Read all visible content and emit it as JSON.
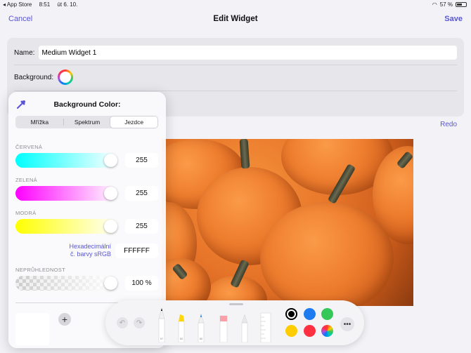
{
  "status_bar": {
    "back_app": "◂ App Store",
    "time": "8:51",
    "date": "út 6. 10.",
    "battery_text": "57 %",
    "battery_level": 0.57
  },
  "nav": {
    "cancel_label": "Cancel",
    "title": "Edit Widget",
    "save_label": "Save"
  },
  "form": {
    "name_label": "Name:",
    "name_value": "Medium Widget 1",
    "background_label": "Background:"
  },
  "redo_label": "Redo",
  "color_picker": {
    "title": "Background Color:",
    "tabs": [
      {
        "label": "Mřížka"
      },
      {
        "label": "Spektrum"
      },
      {
        "label": "Jezdce",
        "active": true
      }
    ],
    "sliders": [
      {
        "label": "ČERVENÁ",
        "value": "255",
        "gradient_from": "#00ffff",
        "gradient_to": "#ffffff"
      },
      {
        "label": "ZELENÁ",
        "value": "255",
        "gradient_from": "#ff00ff",
        "gradient_to": "#ffffff"
      },
      {
        "label": "MODRÁ",
        "value": "255",
        "gradient_from": "#ffff00",
        "gradient_to": "#ffffff"
      }
    ],
    "hex_label_line1": "Hexadecimální",
    "hex_label_line2": "č. barvy sRGB",
    "hex_value": "FFFFFF",
    "opacity_label": "NEPRŮHLEDNOST",
    "opacity_value": "100 %",
    "add_icon": "plus-icon"
  },
  "markup_toolbar": {
    "tools": [
      "pen-tool-icon",
      "highlighter-tool-icon",
      "marker-tool-icon",
      "eraser-tool-icon",
      "lasso-tool-icon",
      "ruler-tool-icon"
    ],
    "tool_labels": [
      "97",
      "50",
      "80"
    ],
    "colors": [
      "#000000",
      "#1e7cf0",
      "#36c759",
      "#ffcc00",
      "#ff3040",
      "multicolor"
    ],
    "selected_color": "#000000"
  },
  "accent_color": "#5856d6"
}
